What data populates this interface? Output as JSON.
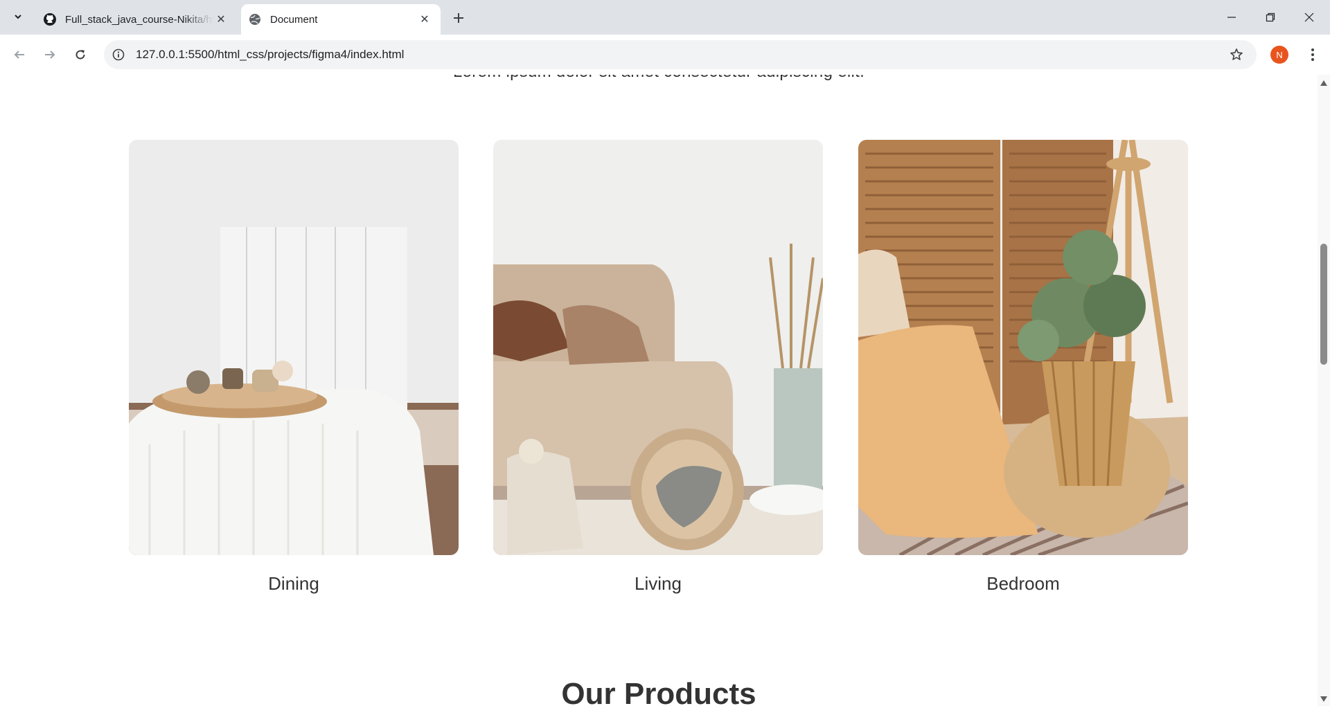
{
  "browser": {
    "tabs": [
      {
        "title": "Full_stack_java_course-Nikita/ht",
        "active": false,
        "icon": "github-icon"
      },
      {
        "title": "Document",
        "active": true,
        "icon": "globe-icon"
      }
    ],
    "url": "127.0.0.1:5500/html_css/projects/figma4/index.html",
    "profile_initial": "N",
    "profile_color": "#e8541e"
  },
  "page": {
    "subtitle": "Lorem ipsum dolor sit amet consectetur adipiscing elit.",
    "categories": [
      {
        "label": "Dining",
        "image": "dining-room-photo"
      },
      {
        "label": "Living",
        "image": "living-room-photo"
      },
      {
        "label": "Bedroom",
        "image": "bedroom-photo"
      }
    ],
    "products_title": "Our Products"
  }
}
